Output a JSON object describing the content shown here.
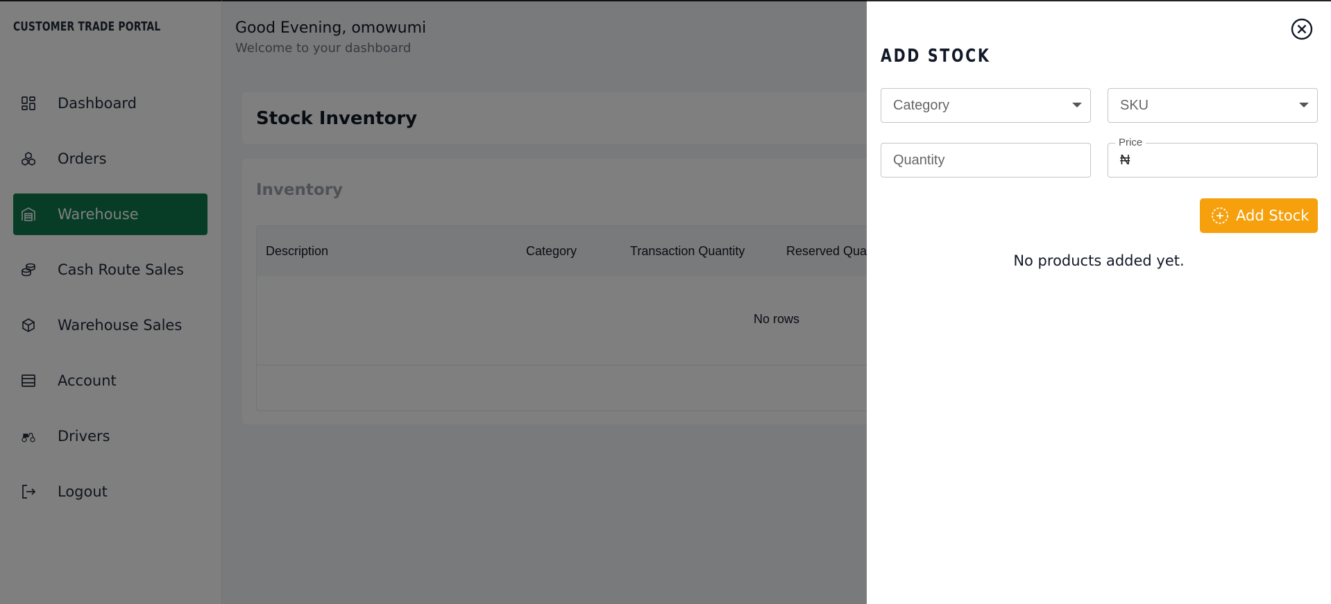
{
  "sidebar": {
    "brand": "CUSTOMER TRADE PORTAL",
    "items": [
      {
        "label": "Dashboard",
        "icon": "dashboard-icon"
      },
      {
        "label": "Orders",
        "icon": "orders-icon"
      },
      {
        "label": "Warehouse",
        "icon": "warehouse-icon",
        "active": true
      },
      {
        "label": "Cash Route Sales",
        "icon": "cash-stack-icon"
      },
      {
        "label": "Warehouse Sales",
        "icon": "box-icon"
      },
      {
        "label": "Account",
        "icon": "account-icon"
      },
      {
        "label": "Drivers",
        "icon": "scooter-icon"
      },
      {
        "label": "Logout",
        "icon": "logout-icon"
      }
    ]
  },
  "header": {
    "greeting": "Good Evening, omowumi",
    "subtitle": "Welcome to your dashboard"
  },
  "main": {
    "page_title": "Stock Inventory",
    "inventory_label": "Inventory",
    "table": {
      "columns": [
        "Description",
        "Category",
        "Transaction Quantity",
        "Reserved Qua"
      ],
      "empty_text": "No rows"
    }
  },
  "drawer": {
    "title": "ADD STOCK",
    "category_placeholder": "Category",
    "sku_placeholder": "SKU",
    "quantity_placeholder": "Quantity",
    "price_label": "Price",
    "price_currency": "₦",
    "add_button": "Add Stock",
    "empty_message": "No products added yet."
  },
  "colors": {
    "accent_green": "#0f7a4f",
    "accent_orange": "#f5a00c"
  }
}
